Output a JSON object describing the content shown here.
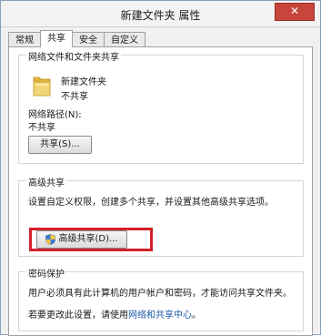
{
  "window": {
    "title": "新建文件夹 属性",
    "close_symbol": "✕"
  },
  "tabs": [
    {
      "label": "常规",
      "active": false
    },
    {
      "label": "共享",
      "active": true
    },
    {
      "label": "安全",
      "active": false
    },
    {
      "label": "自定义",
      "active": false
    }
  ],
  "network_share": {
    "group_title": "网络文件和文件夹共享",
    "folder_name": "新建文件夹",
    "folder_status": "不共享",
    "network_path_label": "网络路径(N):",
    "network_path_value": "不共享",
    "share_button": "共享(S)..."
  },
  "advanced_share": {
    "group_title": "高级共享",
    "description": "设置自定义权限，创建多个共享，并设置其他高级共享选项。",
    "button_label": "高级共享(D)...",
    "highlight_color": "#d3202a"
  },
  "password": {
    "group_title": "密码保护",
    "description": "用户必须具有此计算机的用户帐户和密码，才能访问共享文件夹。",
    "change_prefix": "若要更改此设置，请使用",
    "change_link": "网络和共享中心",
    "change_suffix": "。"
  },
  "colors": {
    "link": "#1c5aa8",
    "close_button": "#c7453a",
    "folder": "#e8c04a"
  }
}
